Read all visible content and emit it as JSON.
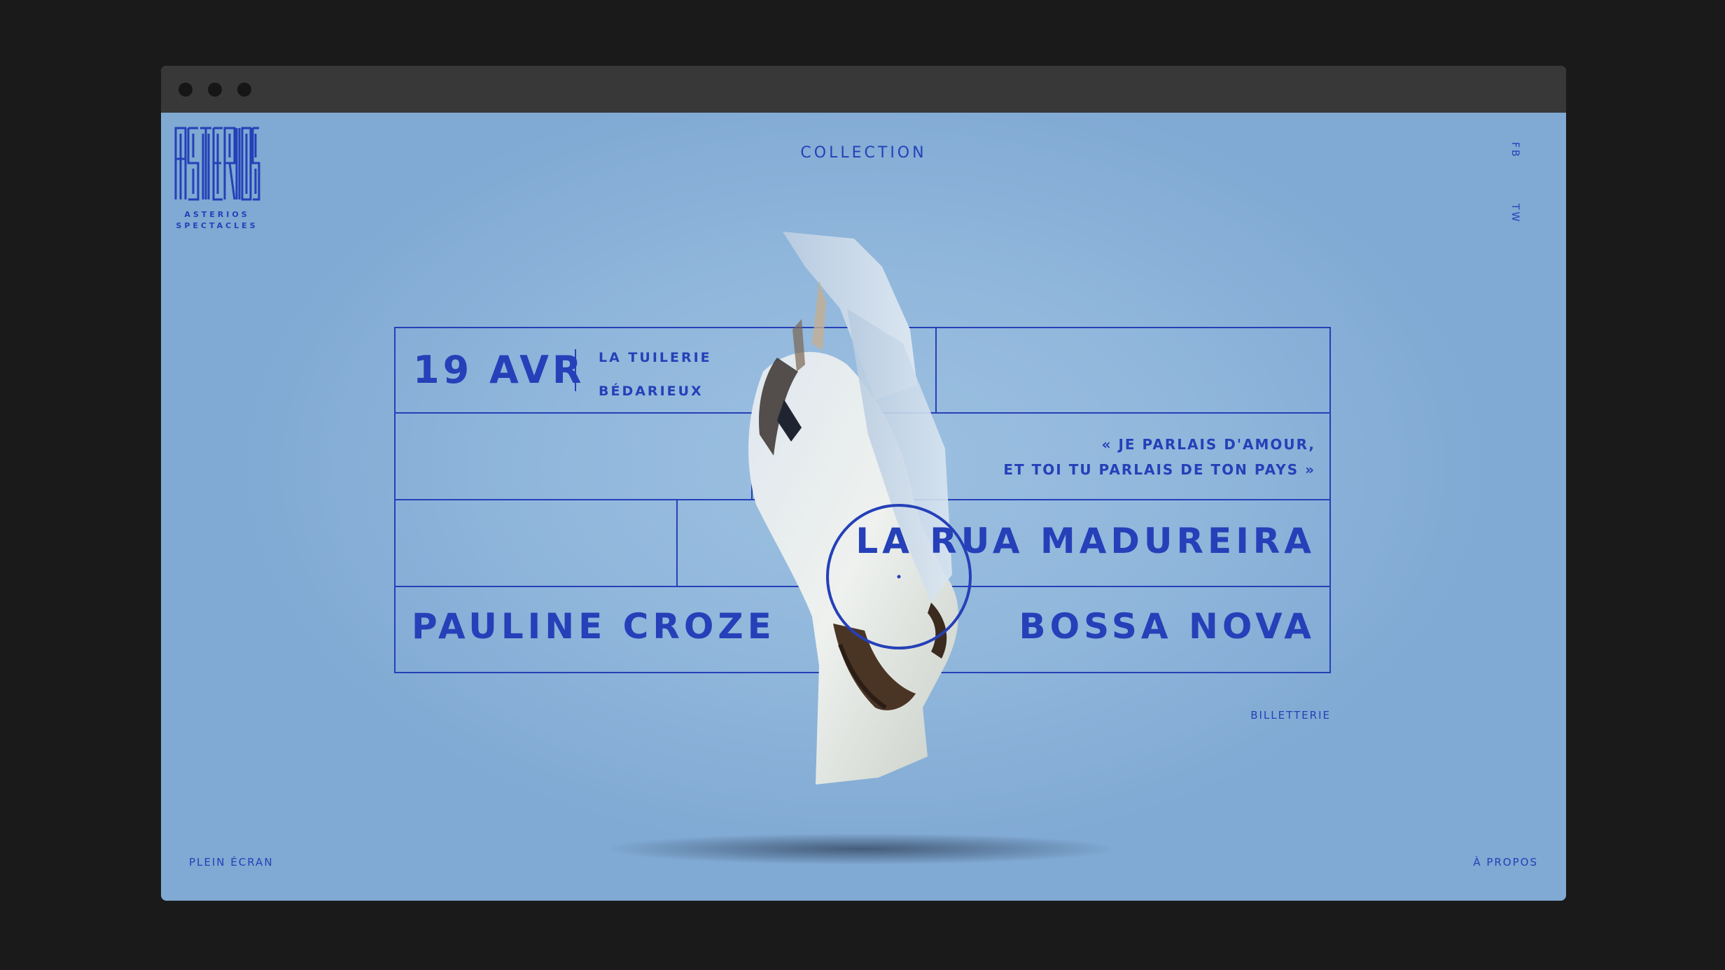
{
  "brand": {
    "logo_caption_1": "ASTERIOS",
    "logo_caption_2": "SPECTACLES"
  },
  "nav": {
    "collection": "COLLECTION",
    "facebook": "FB",
    "twitter": "TW"
  },
  "event": {
    "date": "19 AVR",
    "venue": "LA TUILERIE",
    "city": "BÉDARIEUX",
    "quote_line1": "« JE PARLAIS D'AMOUR,",
    "quote_line2": "ET TOI TU PARLAIS DE TON PAYS »",
    "title": "LA RUA MADUREIRA",
    "artist": "PAULINE CROZE",
    "genre": "BOSSA NOVA"
  },
  "links": {
    "tickets": "BILLETTERIE",
    "fullscreen": "PLEIN ÉCRAN",
    "about": "À PROPOS"
  },
  "colors": {
    "accent": "#2540b8",
    "background": "#8fb4d8",
    "chrome": "#383838"
  }
}
